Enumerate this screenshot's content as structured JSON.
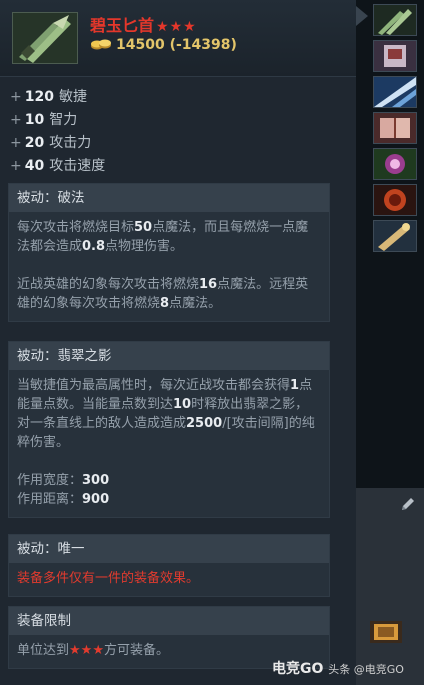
{
  "item": {
    "name": "碧玉匕首",
    "stars": "★★★",
    "cost": "14500",
    "cost_delta": "(-14398)"
  },
  "attributes": [
    {
      "plus": "+",
      "value": "120",
      "label": "敏捷"
    },
    {
      "plus": "+",
      "value": "10",
      "label": "智力"
    },
    {
      "plus": "+",
      "value": "20",
      "label": "攻击力"
    },
    {
      "plus": "+",
      "value": "40",
      "label": "攻击速度"
    }
  ],
  "sections": {
    "mana_break": {
      "title": "被动：破法",
      "p1_a": "每次攻击将燃烧目标",
      "p1_b": "50",
      "p1_c": "点魔法，而且每燃烧一点魔法都会造成",
      "p1_d": "0.8",
      "p1_e": "点物理伤害。",
      "p2_a": "近战英雄的幻象每次攻击将燃烧",
      "p2_b": "16",
      "p2_c": "点魔法。远程英雄的幻象每次攻击将燃烧",
      "p2_d": "8",
      "p2_e": "点魔法。"
    },
    "jade_shadow": {
      "title": "被动：翡翠之影",
      "p1_a": "当敏捷值为最高属性时，每次近战攻击都会获得",
      "p1_b": "1",
      "p1_c": "点能量点数。当能量点数到达",
      "p1_d": "10",
      "p1_e": "时释放出翡翠之影，对一条直线上的敌人造成造成",
      "p1_f": "2500",
      "p1_g": "/[攻击间隔]的纯粹伤害。",
      "width_label": "作用宽度：",
      "width_value": "300",
      "range_label": "作用距离：",
      "range_value": "900"
    },
    "unique": {
      "title": "被动：唯一",
      "text": "装备多件仅有一件的装备效果。"
    },
    "restriction": {
      "title": "装备限制",
      "text_a": "单位达到",
      "stars": "★★★",
      "text_b": "方可装备。"
    }
  },
  "watermark": {
    "main": "电竞GO",
    "sub": "头条 @电竞GO"
  },
  "colors": {
    "title_red": "#e4372b",
    "gold": "#e3c56a",
    "panel": "#27313b",
    "panel_header": "#36414c"
  },
  "icons": [
    "item-jade-dagger-icon",
    "gold-coin-icon",
    "inventory-item-1-icon",
    "inventory-item-2-icon",
    "inventory-item-3-icon",
    "inventory-item-4-icon",
    "inventory-item-5-icon",
    "inventory-item-6-icon",
    "inventory-item-7-icon",
    "edit-pen-icon",
    "scroll-icon"
  ]
}
